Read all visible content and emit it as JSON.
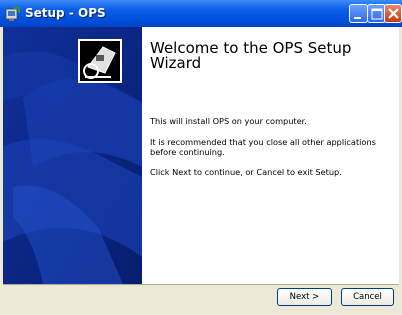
{
  "window": {
    "title": "Setup - OPS",
    "controls": {
      "minimize": "minimize-icon",
      "maximize": "maximize-icon",
      "close": "close-icon"
    }
  },
  "wizard": {
    "heading": "Welcome to the OPS Setup Wizard",
    "paragraphs": [
      "This will install OPS on your computer.",
      "It is recommended that you close all other applications before continuing.",
      "Click Next to continue, or Cancel to exit Setup."
    ]
  },
  "buttons": {
    "next_label": "Next >",
    "cancel_label": "Cancel"
  },
  "colors": {
    "titlebar": "#0a5fe8",
    "sidebar": "#0a2c8a",
    "close_button": "#c23a12"
  }
}
